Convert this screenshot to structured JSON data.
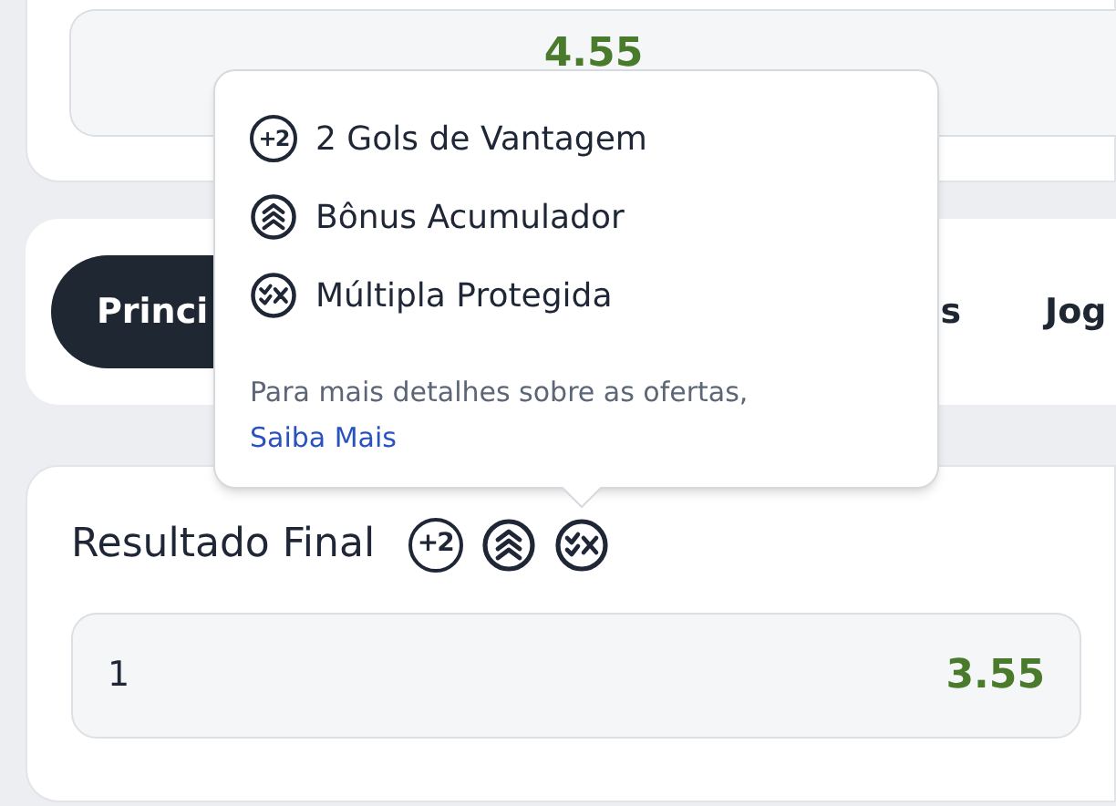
{
  "top_market": {
    "odd": "4.55"
  },
  "tabs": [
    {
      "label": "Princi",
      "selected": true
    },
    {
      "label": "s",
      "selected": false
    },
    {
      "label": "Jog",
      "selected": false
    }
  ],
  "market": {
    "title": "Resultado Final",
    "badges": [
      {
        "kind": "goals",
        "text": "+2"
      },
      {
        "kind": "boost"
      },
      {
        "kind": "protected"
      }
    ],
    "selections": [
      {
        "label": "1",
        "odd": "3.55"
      }
    ]
  },
  "tooltip": {
    "offers": [
      {
        "kind": "goals",
        "text": "+2",
        "label": "2 Gols de Vantagem"
      },
      {
        "kind": "boost",
        "label": "Bônus Acumulador"
      },
      {
        "kind": "protected",
        "label": "Múltipla Protegida"
      }
    ],
    "note": "Para mais detalhes sobre as ofertas,",
    "link": "Saiba Mais"
  }
}
